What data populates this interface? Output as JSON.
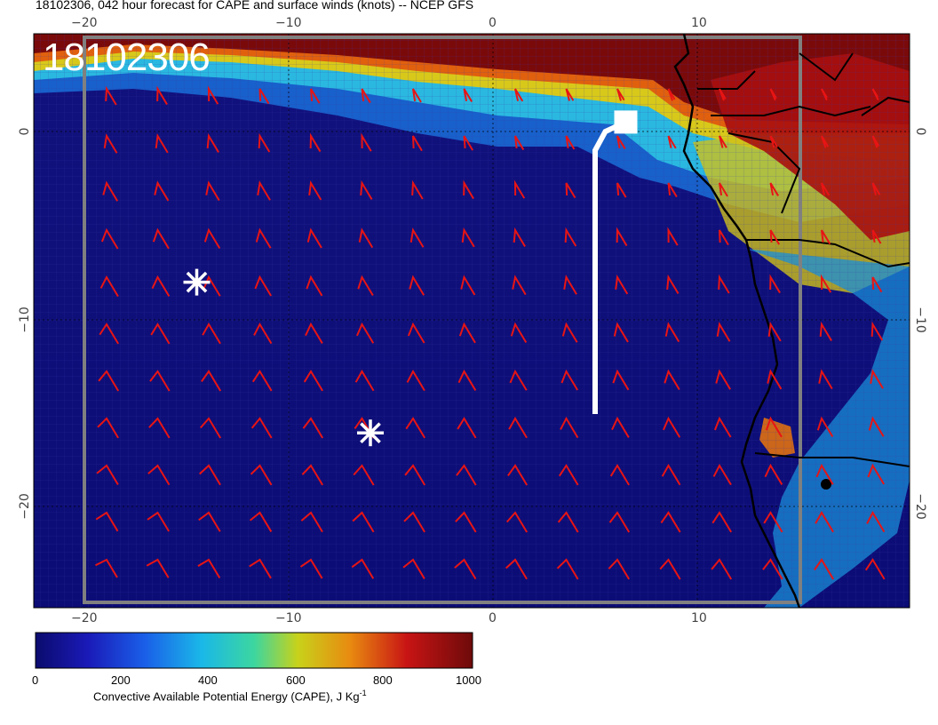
{
  "title": "18102306, 042 hour forecast for CAPE and surface winds (knots) -- NCEP GFS",
  "stamp": "18102306",
  "axes": {
    "x_top_ticks": [
      "−20",
      "−10",
      "0",
      "10"
    ],
    "x_bottom_ticks": [
      "−20",
      "−10",
      "0",
      "10"
    ],
    "y_left_ticks": [
      "0",
      "−10",
      "−20"
    ],
    "y_right_ticks": [
      "0",
      "−10",
      "−20"
    ]
  },
  "colorbar": {
    "ticks": [
      "0",
      "200",
      "400",
      "600",
      "800",
      "1000"
    ],
    "label": "Convective Available Potential Energy (CAPE), J Kg",
    "label_sup": "-1",
    "range": [
      0,
      1000
    ],
    "colors": [
      "#0b0b6e",
      "#1a2fd0",
      "#1aa6e8",
      "#3cd6c8",
      "#c8d21a",
      "#e88a10",
      "#c81414",
      "#6e0a0a"
    ]
  },
  "markers": [
    {
      "name": "asterisk-marker-1",
      "lon": -14.5,
      "lat": -8
    },
    {
      "name": "asterisk-marker-2",
      "lon": -6,
      "lat": -16
    }
  ],
  "flight_track": {
    "lon": [
      5,
      5,
      5.5,
      6.5
    ],
    "lat": [
      -15,
      -1,
      0,
      0.5
    ]
  },
  "colors": {
    "wind_barb": "#e81414",
    "coast": "#000000",
    "track": "#ffffff",
    "box": "#808080"
  }
}
